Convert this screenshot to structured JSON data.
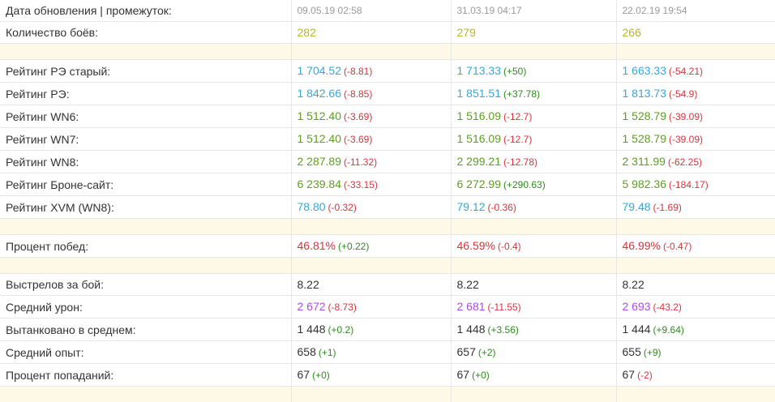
{
  "colors": {
    "date": "#9a9a9a",
    "battles": "#b5b434",
    "blue": "#36a7d8",
    "green": "#5e9e1e",
    "red": "#d9343c",
    "purple": "#b249e6",
    "dark": "#333333",
    "neg": "#d9343c",
    "pos": "#2e8b1e",
    "spacer": "#fdf9e6"
  },
  "rows": [
    {
      "type": "header",
      "label": "Дата обновления | промежуток:",
      "cells": [
        {
          "value": "09.05.19 02:58"
        },
        {
          "value": "31.03.19 04:17"
        },
        {
          "value": "22.02.19 19:54"
        }
      ]
    },
    {
      "type": "data",
      "label": "Количество боёв:",
      "color": "battles",
      "cells": [
        {
          "value": "282",
          "delta": ""
        },
        {
          "value": "279",
          "delta": ""
        },
        {
          "value": "266",
          "delta": ""
        }
      ]
    },
    {
      "type": "spacer"
    },
    {
      "type": "data",
      "label": "Рейтинг РЭ старый:",
      "color": "blue",
      "cells": [
        {
          "value": "1 704.52",
          "delta": "(-8.81)",
          "dsign": "neg"
        },
        {
          "value": "1 713.33",
          "delta": "(+50)",
          "dsign": "pos"
        },
        {
          "value": "1 663.33",
          "delta": "(-54.21)",
          "dsign": "neg"
        }
      ]
    },
    {
      "type": "data",
      "label": "Рейтинг РЭ:",
      "color": "blue",
      "cells": [
        {
          "value": "1 842.66",
          "delta": "(-8.85)",
          "dsign": "neg"
        },
        {
          "value": "1 851.51",
          "delta": "(+37.78)",
          "dsign": "pos"
        },
        {
          "value": "1 813.73",
          "delta": "(-54.9)",
          "dsign": "neg"
        }
      ]
    },
    {
      "type": "data",
      "label": "Рейтинг WN6:",
      "color": "green",
      "cells": [
        {
          "value": "1 512.40",
          "delta": "(-3.69)",
          "dsign": "neg"
        },
        {
          "value": "1 516.09",
          "delta": "(-12.7)",
          "dsign": "neg"
        },
        {
          "value": "1 528.79",
          "delta": "(-39.09)",
          "dsign": "neg"
        }
      ]
    },
    {
      "type": "data",
      "label": "Рейтинг WN7:",
      "color": "green",
      "cells": [
        {
          "value": "1 512.40",
          "delta": "(-3.69)",
          "dsign": "neg"
        },
        {
          "value": "1 516.09",
          "delta": "(-12.7)",
          "dsign": "neg"
        },
        {
          "value": "1 528.79",
          "delta": "(-39.09)",
          "dsign": "neg"
        }
      ]
    },
    {
      "type": "data",
      "label": "Рейтинг WN8:",
      "color": "green",
      "cells": [
        {
          "value": "2 287.89",
          "delta": "(-11.32)",
          "dsign": "neg"
        },
        {
          "value": "2 299.21",
          "delta": "(-12.78)",
          "dsign": "neg"
        },
        {
          "value": "2 311.99",
          "delta": "(-62.25)",
          "dsign": "neg"
        }
      ]
    },
    {
      "type": "data",
      "label": "Рейтинг Броне-сайт:",
      "color": "green",
      "cells": [
        {
          "value": "6 239.84",
          "delta": "(-33.15)",
          "dsign": "neg"
        },
        {
          "value": "6 272.99",
          "delta": "(+290.63)",
          "dsign": "pos"
        },
        {
          "value": "5 982.36",
          "delta": "(-184.17)",
          "dsign": "neg"
        }
      ]
    },
    {
      "type": "data",
      "label": "Рейтинг XVM (WN8):",
      "color": "blue",
      "cells": [
        {
          "value": "78.80",
          "delta": "(-0.32)",
          "dsign": "neg"
        },
        {
          "value": "79.12",
          "delta": "(-0.36)",
          "dsign": "neg"
        },
        {
          "value": "79.48",
          "delta": "(-1.69)",
          "dsign": "neg"
        }
      ]
    },
    {
      "type": "spacer"
    },
    {
      "type": "data",
      "label": "Процент побед:",
      "color": "red",
      "cells": [
        {
          "value": "46.81%",
          "delta": "(+0.22)",
          "dsign": "pos"
        },
        {
          "value": "46.59%",
          "delta": "(-0.4)",
          "dsign": "neg"
        },
        {
          "value": "46.99%",
          "delta": "(-0.47)",
          "dsign": "neg"
        }
      ]
    },
    {
      "type": "spacer"
    },
    {
      "type": "data",
      "label": "Выстрелов за бой:",
      "color": "dark",
      "cells": [
        {
          "value": "8.22",
          "delta": ""
        },
        {
          "value": "8.22",
          "delta": ""
        },
        {
          "value": "8.22",
          "delta": ""
        }
      ]
    },
    {
      "type": "data",
      "label": "Средний урон:",
      "color": "purple",
      "cells": [
        {
          "value": "2 672",
          "delta": "(-8.73)",
          "dsign": "neg"
        },
        {
          "value": "2 681",
          "delta": "(-11.55)",
          "dsign": "neg"
        },
        {
          "value": "2 693",
          "delta": "(-43.2)",
          "dsign": "neg"
        }
      ]
    },
    {
      "type": "data",
      "label": "Вытанковано в среднем:",
      "color": "dark",
      "cells": [
        {
          "value": "1 448",
          "delta": "(+0.2)",
          "dsign": "pos"
        },
        {
          "value": "1 448",
          "delta": "(+3.56)",
          "dsign": "pos"
        },
        {
          "value": "1 444",
          "delta": "(+9.64)",
          "dsign": "pos"
        }
      ]
    },
    {
      "type": "data",
      "label": "Средний опыт:",
      "color": "dark",
      "cells": [
        {
          "value": "658",
          "delta": "(+1)",
          "dsign": "pos"
        },
        {
          "value": "657",
          "delta": "(+2)",
          "dsign": "pos"
        },
        {
          "value": "655",
          "delta": "(+9)",
          "dsign": "pos"
        }
      ]
    },
    {
      "type": "data",
      "label": "Процент попаданий:",
      "color": "dark",
      "cells": [
        {
          "value": "67",
          "delta": "(+0)",
          "dsign": "pos"
        },
        {
          "value": "67",
          "delta": "(+0)",
          "dsign": "pos"
        },
        {
          "value": "67",
          "delta": "(-2)",
          "dsign": "neg"
        }
      ]
    },
    {
      "type": "spacer"
    }
  ]
}
